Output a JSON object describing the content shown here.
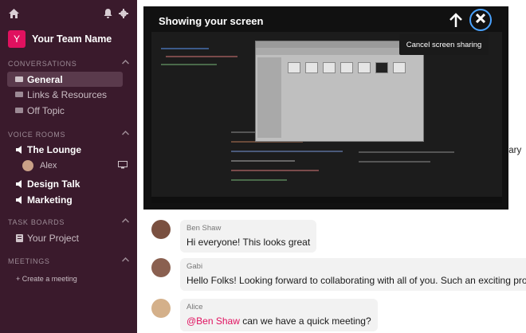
{
  "team": {
    "initial": "Y",
    "name": "Your Team Name"
  },
  "sections": {
    "conversations": "CONVERSATIONS",
    "voice_rooms": "VOICE ROOMS",
    "task_boards": "TASK BOARDS",
    "meetings": "MEETINGS"
  },
  "conversations": [
    {
      "label": "General"
    },
    {
      "label": "Links & Resources"
    },
    {
      "label": "Off Topic"
    }
  ],
  "voice_rooms": {
    "lounge": "The Lounge",
    "lounge_user": "Alex",
    "design_talk": "Design Talk",
    "marketing": "Marketing"
  },
  "task_boards": {
    "project": "Your Project"
  },
  "meetings": {
    "create": "+ Create a meeting"
  },
  "screen_share": {
    "title": "Showing your screen",
    "tooltip": "Cancel screen sharing"
  },
  "cut_text": "ruary",
  "messages": [
    {
      "name": "Ben Shaw",
      "text": "Hi everyone! This looks great"
    },
    {
      "name": "Gabi",
      "text": "Hello Folks! Looking forward to collaborating with all of you. Such an exciting project"
    },
    {
      "name": "Alice",
      "mention": "@Ben Shaw",
      "text": " can we have a quick meeting?"
    }
  ],
  "colors": {
    "sidebar": "#3a1a2c",
    "accent": "#e0115f",
    "focus_ring": "#4aa3ff"
  }
}
